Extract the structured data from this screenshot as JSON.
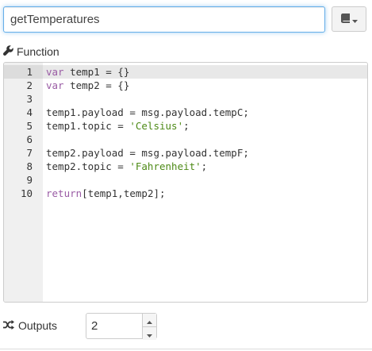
{
  "name_field": {
    "value": "getTemperatures"
  },
  "function_label": "Function",
  "editor": {
    "lines": [
      {
        "num": "1",
        "tokens": [
          {
            "t": "var",
            "k": "kw"
          },
          {
            "t": " temp1 = {}",
            "k": ""
          }
        ]
      },
      {
        "num": "2",
        "tokens": [
          {
            "t": "var",
            "k": "kw"
          },
          {
            "t": " temp2 = {}",
            "k": ""
          }
        ]
      },
      {
        "num": "3",
        "tokens": []
      },
      {
        "num": "4",
        "tokens": [
          {
            "t": "temp1.payload = msg.payload.tempC;",
            "k": ""
          }
        ]
      },
      {
        "num": "5",
        "tokens": [
          {
            "t": "temp1.topic = ",
            "k": ""
          },
          {
            "t": "'Celsius'",
            "k": "str"
          },
          {
            "t": ";",
            "k": ""
          }
        ]
      },
      {
        "num": "6",
        "tokens": []
      },
      {
        "num": "7",
        "tokens": [
          {
            "t": "temp2.payload = msg.payload.tempF;",
            "k": ""
          }
        ]
      },
      {
        "num": "8",
        "tokens": [
          {
            "t": "temp2.topic = ",
            "k": ""
          },
          {
            "t": "'Fahrenheit'",
            "k": "str"
          },
          {
            "t": ";",
            "k": ""
          }
        ]
      },
      {
        "num": "9",
        "tokens": []
      },
      {
        "num": "10",
        "tokens": [
          {
            "t": "return",
            "k": "kw"
          },
          {
            "t": "[temp1,temp2];",
            "k": ""
          }
        ]
      }
    ]
  },
  "outputs": {
    "label": "Outputs",
    "value": "2"
  },
  "icons": {
    "book_button": "book-icon",
    "function_label": "wrench-icon",
    "outputs_label": "shuffle-icon",
    "spinner_up": "caret-up-icon",
    "spinner_down": "caret-down-icon"
  },
  "colors": {
    "keyword": "#9a5ca5",
    "string": "#4d8a16",
    "focus_border": "#66afe9"
  }
}
